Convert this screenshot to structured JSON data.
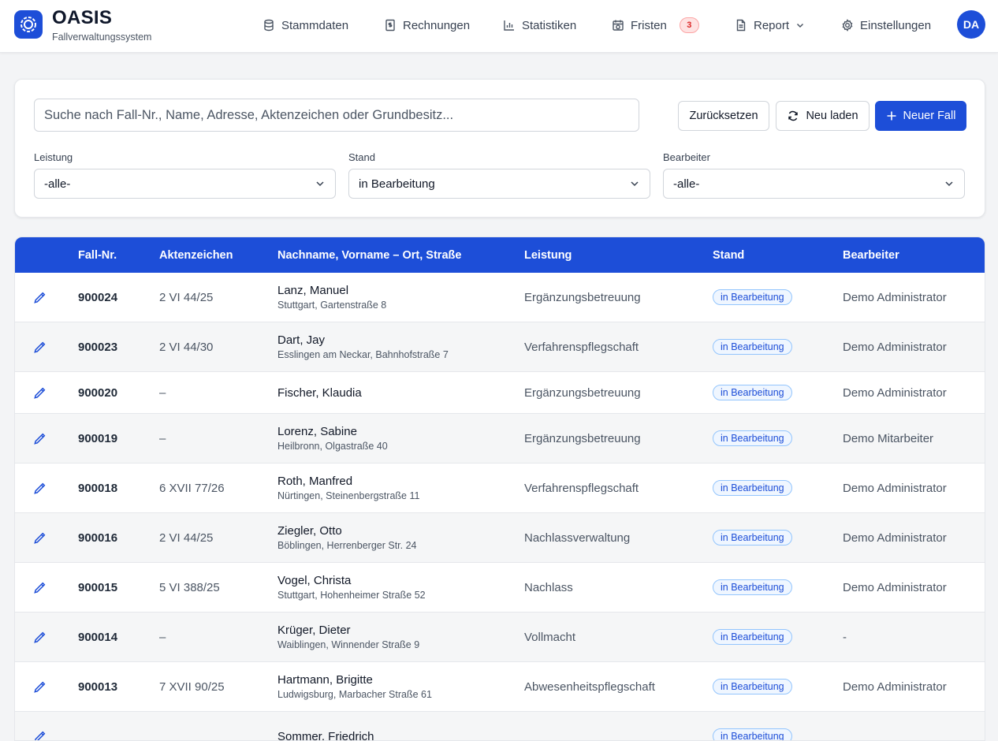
{
  "app": {
    "title": "OASIS",
    "subtitle": "Fallverwaltungssystem"
  },
  "nav": [
    {
      "label": "Stammdaten",
      "icon": "database-icon"
    },
    {
      "label": "Rechnungen",
      "icon": "invoice-icon"
    },
    {
      "label": "Statistiken",
      "icon": "bar-chart-icon"
    },
    {
      "label": "Fristen",
      "icon": "calendar-clock-icon",
      "badge": "3"
    },
    {
      "label": "Report",
      "icon": "document-icon"
    },
    {
      "label": "Einstellungen",
      "icon": "gear-icon"
    }
  ],
  "user": {
    "initials": "DA"
  },
  "filters": {
    "search_placeholder": "Suche nach Fall-Nr., Name, Adresse, Aktenzeichen oder Grundbesitz...",
    "reset_label": "Zurücksetzen",
    "reload_label": "Neu laden",
    "new_case_label": "Neuer Fall",
    "leistung": {
      "label": "Leistung",
      "value": "-alle-"
    },
    "stand": {
      "label": "Stand",
      "value": "in Bearbeitung"
    },
    "bearbeiter": {
      "label": "Bearbeiter",
      "value": "-alle-"
    }
  },
  "colors": {
    "primary": "#1d4ed8",
    "badge_red": "#dc2626"
  },
  "table": {
    "headers": [
      "Fall-Nr.",
      "Aktenzeichen",
      "Nachname, Vorname – Ort, Straße",
      "Leistung",
      "Stand",
      "Bearbeiter"
    ],
    "rows": [
      {
        "fallnr": "900024",
        "akz": "2 VI 44/25",
        "name": "Lanz, Manuel",
        "addr": "Stuttgart, Gartenstraße 8",
        "leistung": "Ergänzungsbetreuung",
        "stand": "in Bearbeitung",
        "bearbeiter": "Demo Administrator"
      },
      {
        "fallnr": "900023",
        "akz": "2 VI 44/30",
        "name": "Dart, Jay",
        "addr": "Esslingen am Neckar, Bahnhofstraße 7",
        "leistung": "Verfahrenspflegschaft",
        "stand": "in Bearbeitung",
        "bearbeiter": "Demo Administrator"
      },
      {
        "fallnr": "900020",
        "akz": "–",
        "name": "Fischer, Klaudia",
        "addr": "",
        "leistung": "Ergänzungsbetreuung",
        "stand": "in Bearbeitung",
        "bearbeiter": "Demo Administrator"
      },
      {
        "fallnr": "900019",
        "akz": "–",
        "name": "Lorenz, Sabine",
        "addr": "Heilbronn, Olgastraße 40",
        "leistung": "Ergänzungsbetreuung",
        "stand": "in Bearbeitung",
        "bearbeiter": "Demo Mitarbeiter"
      },
      {
        "fallnr": "900018",
        "akz": "6 XVII 77/26",
        "name": "Roth, Manfred",
        "addr": "Nürtingen, Steinenbergstraße 11",
        "leistung": "Verfahrenspflegschaft",
        "stand": "in Bearbeitung",
        "bearbeiter": "Demo Administrator"
      },
      {
        "fallnr": "900016",
        "akz": "2 VI 44/25",
        "name": "Ziegler, Otto",
        "addr": "Böblingen, Herrenberger Str. 24",
        "leistung": "Nachlassverwaltung",
        "stand": "in Bearbeitung",
        "bearbeiter": "Demo Administrator"
      },
      {
        "fallnr": "900015",
        "akz": "5 VI 388/25",
        "name": "Vogel, Christa",
        "addr": "Stuttgart, Hohenheimer Straße 52",
        "leistung": "Nachlass",
        "stand": "in Bearbeitung",
        "bearbeiter": "Demo Administrator"
      },
      {
        "fallnr": "900014",
        "akz": "–",
        "name": "Krüger, Dieter",
        "addr": "Waiblingen, Winnender Straße 9",
        "leistung": "Vollmacht",
        "stand": "in Bearbeitung",
        "bearbeiter": "-"
      },
      {
        "fallnr": "900013",
        "akz": "7 XVII 90/25",
        "name": "Hartmann, Brigitte",
        "addr": "Ludwigsburg, Marbacher Straße 61",
        "leistung": "Abwesenheitspflegschaft",
        "stand": "in Bearbeitung",
        "bearbeiter": "Demo Administrator"
      },
      {
        "fallnr": "",
        "akz": "",
        "name": "Sommer, Friedrich",
        "addr": "",
        "leistung": "",
        "stand": "in Bearbeitung",
        "bearbeiter": ""
      }
    ]
  }
}
